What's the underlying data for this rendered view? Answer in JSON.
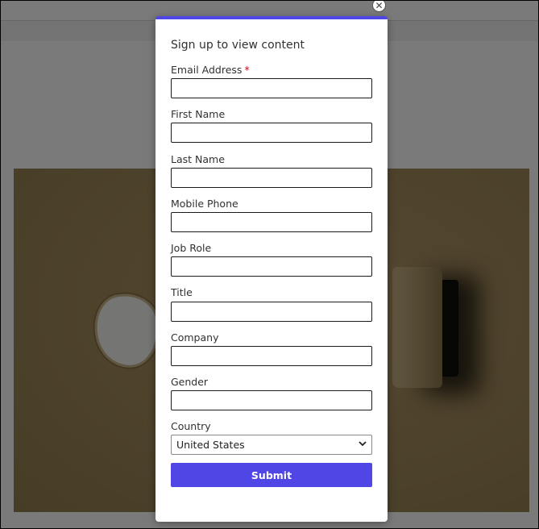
{
  "form": {
    "title": "Sign up to view content",
    "required_marker": "*",
    "fields": [
      {
        "label": "Email Address",
        "value": "",
        "required": true
      },
      {
        "label": "First Name",
        "value": ""
      },
      {
        "label": "Last Name",
        "value": ""
      },
      {
        "label": "Mobile Phone",
        "value": ""
      },
      {
        "label": "Job Role",
        "value": ""
      },
      {
        "label": "Title",
        "value": ""
      },
      {
        "label": "Company",
        "value": ""
      },
      {
        "label": "Gender",
        "value": ""
      }
    ],
    "country": {
      "label": "Country",
      "selected": "United States"
    },
    "submit_label": "Submit"
  },
  "icons": {
    "close": "close-icon",
    "dropdown": "chevron-down-icon"
  },
  "colors": {
    "accent": "#5046e5",
    "required": "#c50f1f",
    "overlay": "rgba(0,0,0,0.52)"
  }
}
